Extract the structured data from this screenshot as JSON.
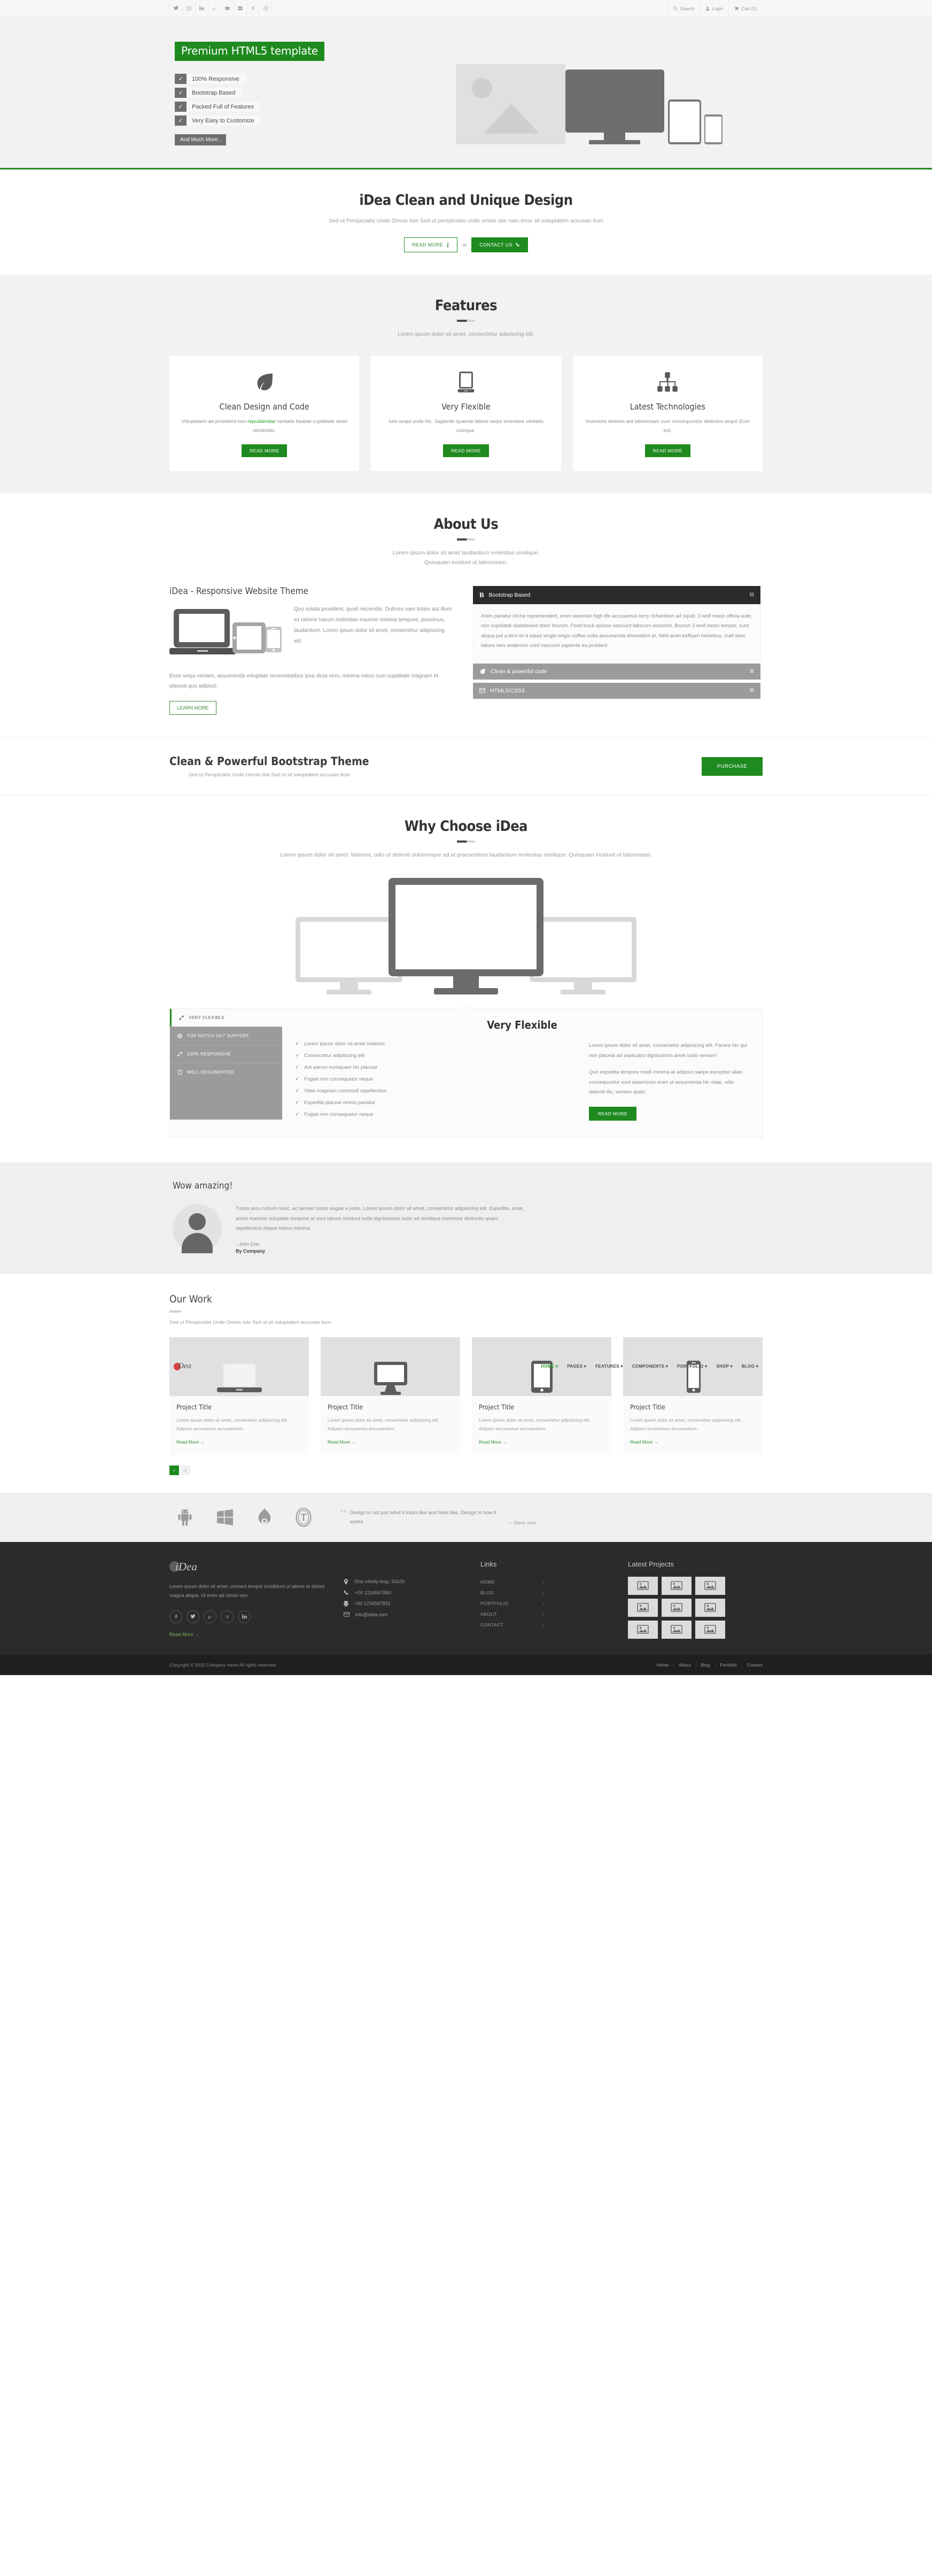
{
  "topbar": {
    "social": [
      "twitter-icon",
      "skype-icon",
      "linkedin-icon",
      "google-plus-icon",
      "youtube-icon",
      "flickr-icon",
      "facebook-icon",
      "pinterest-icon"
    ],
    "search": "Search",
    "login": "Login",
    "cart": "Cart (0)"
  },
  "hero": {
    "badge": "Premium HTML5 template",
    "features": [
      "100% Responsive",
      "Bootstrap Based",
      "Packed Full of Features",
      "Very Easy to Customize"
    ],
    "more": "And Much More.."
  },
  "intro": {
    "title": "iDea Clean and Unique Design",
    "subtitle": "Sed ut Perspiciatis Unde Omnis Iste Sed ut perspiciatis unde omnis iste natu error sit voluptatem accusan tium",
    "read_more": "READ MORE",
    "or": "or",
    "contact_us": "CONTACT US"
  },
  "features": {
    "title": "Features",
    "subtitle": "Lorem ipsum dolor sit amet, consectetur adipiscing elit.",
    "cards": [
      {
        "icon": "leaf-icon",
        "title": "Clean Design and Code",
        "text_before": "Voluptatem ad provident non ",
        "highlight": "repudiandae",
        "text_after": " veritatis beatae cupiditate amet reiciendis.",
        "button": "READ MORE"
      },
      {
        "icon": "tablet-icon",
        "title": "Very Flexible",
        "text_before": "Iure sequi unde hic. Sapiente quaerat labore sequi inventore veritatis cumque.",
        "highlight": "",
        "text_after": "",
        "button": "READ MORE"
      },
      {
        "icon": "sitemap-icon",
        "title": "Latest Technologies",
        "text_before": "Inventore dolores aut laboriosam cum consequuntur delectus sequi! Eum est.",
        "highlight": "",
        "text_after": "",
        "button": "READ MORE"
      }
    ]
  },
  "about": {
    "title": "About Us",
    "subtitle": "Lorem ipsum dolor sit amet laudantium molestias similique.\nQuisquam incidunt ut laboriosam.",
    "heading": "iDea - Responsive Website Theme",
    "paragraph1": "Quo soluta provident, quod reiciendis. Dolores nam totam aut illum ex ratione harum molestias maxime minima tempore, possimus, laudantium. Lorem ipsum dolor sit amet, consectetur adipisicing elit.",
    "paragraph2": "Esse sequi veniam, assumenda voluptate necessitatibus ipsa dicta vero, minima natus cum cupiditate magnam et placeat quo adipisci.",
    "learn_more": "LEARN MORE",
    "accordion": [
      {
        "icon": "bootstrap-icon",
        "label": "Bootstrap Based",
        "state": "open",
        "sign": "⊟",
        "body": "Anim pariatur cliche reprehenderit, enim eiusmod high life accusamus terry richardson ad squid. 3 wolf moon officia aute, non cupidatat skateboard dolor brunch. Food truck quinoa nesciunt laborum eiusmod. Brunch 3 wolf moon tempor, sunt aliqua put a bird on it squid single-origin coffee nulla assumenda shoreditch et. Nihil anim keffiyeh helvetica, craft beer labore wes anderson cred nesciunt sapiente ea proident."
      },
      {
        "icon": "leaf-icon",
        "label": "Clean & powerful code",
        "state": "closed",
        "sign": "⊞",
        "body": ""
      },
      {
        "icon": "code-icon",
        "label": "HTML5/CSS3",
        "state": "closed",
        "sign": "⊞",
        "body": ""
      }
    ]
  },
  "cta": {
    "title": "Clean & Powerful Bootstrap Theme",
    "subtitle": "Sed ut Perspiciatis Unde Omnis Iste Sed ut sit voluptatem accusan tium",
    "button": "PURCHASE"
  },
  "why": {
    "title": "Why Choose iDea",
    "subtitle": "Lorem ipsum dolor sit amet. Maiores, odio ut deleniti doloremque ad at praesentium laudantium molestias similique. Quisquam incidunt ut laboriosam.",
    "tabs": [
      {
        "icon": "expand-icon",
        "label": "VERY FLEXIBLE",
        "active": true
      },
      {
        "icon": "lifebuoy-icon",
        "label": "TOP NOTCH 24/7 SUPPORT",
        "active": false
      },
      {
        "icon": "expand-icon",
        "label": "100% RESPONSIVE",
        "active": false
      },
      {
        "icon": "file-icon",
        "label": "WELL DOCUMENTED",
        "active": false
      }
    ],
    "panel_title": "Very Flexible",
    "checklist": [
      "Lorem ipsum dolor sit amet maiores",
      "Consectetur adipisicing elit",
      "Aut earum numquam hic placeat",
      "Fugiat rem consequatur neque",
      "Vitae magnam commodi repellendus",
      "Expedita placeat omnis pariatur",
      "Fugiat rem consequatur neque"
    ],
    "paragraph1": "Lorem ipsum dolor sit amet, consectetur adipisicing elit. Facere hic qui non placeat ad explicabo dignissimos amet iusto veniam!",
    "paragraph2": "Quo expedita tempore modi minima at adipisci saepe excepturi alias consequuntur sunt asperiores enim ut assumenda hic vitae, odio deleniti illo, veniam quas!",
    "button": "READ MORE"
  },
  "testimonial": {
    "title": "Wow amazing!",
    "text": "Turpis arcu rutrum nunc, ac laoreet turpis augue a justo. Lorem ipsum dolor sit amet, consectetur adipisicing elit. Expedita, esse, animi maxime voluptate tempore at sunt labore incidunt nulla dignissimos iusto ad similique inventore distinctio quam repellendus itaque minus minima.",
    "author": "- John Doe",
    "company": "By Company"
  },
  "work": {
    "title": "Our Work",
    "subtitle": "Sed ut Perspiciatis Unde Omnis Iste Sed ut sit voluptatem accusan tium",
    "nav_logo": "Dea",
    "nav_items": [
      "HOME",
      "PAGES",
      "FEATURES",
      "COMPONENTS",
      "PORTFOLIO",
      "SHOP",
      "BLOG"
    ],
    "projects": [
      {
        "thumb": "laptop-icon",
        "title": "Project Title",
        "text": "Lorem ipsum dolor sit amet, consectetur adipisicing elit. Adipisci accusamus accusantium.",
        "link": "Read More →"
      },
      {
        "thumb": "desktop-icon",
        "title": "Project Title",
        "text": "Lorem ipsum dolor sit amet, consectetur adipisicing elit. Adipisci accusamus accusantium.",
        "link": "Read More →"
      },
      {
        "thumb": "tablet-icon",
        "title": "Project Title",
        "text": "Lorem ipsum dolor sit amet, consectetur adipisicing elit. Adipisci accusamus accusantium.",
        "link": "Read More →"
      },
      {
        "thumb": "mobile-icon",
        "title": "Project Title",
        "text": "Lorem ipsum dolor sit amet, consectetur adipisicing elit. Adipisci accusamus accusantium.",
        "link": "Read More →"
      }
    ],
    "pager_prev": "‹",
    "pager_next": "›"
  },
  "brands": {
    "icons": [
      "android-icon",
      "windows-icon",
      "drupal-icon",
      "wordpress-icon"
    ],
    "quote": "Design is not just what it looks like and feels like. Design is how it works.",
    "author": "— Steve Jobs"
  },
  "footer": {
    "logo": "Dea",
    "about": "Lorem ipsum dolor sit amet, consect tempor incididunt ut labore et dolore magna aliqua. Ut enim ad minim ven.",
    "social": [
      "facebook-icon",
      "twitter-icon",
      "google-plus-icon",
      "skype-icon",
      "linkedin-icon"
    ],
    "read_more": "Read More →",
    "links_title": "Links",
    "links": [
      "HOME",
      "BLOG",
      "PORTFOLIO",
      "ABOUT",
      "CONTACT"
    ],
    "contact": [
      {
        "icon": "location-icon",
        "text": "One infinity loop, 54100"
      },
      {
        "icon": "phone-icon",
        "text": "+00 1234567890"
      },
      {
        "icon": "fax-icon",
        "text": "+00 1234567891"
      },
      {
        "icon": "mail-icon",
        "text": "info@idea.com"
      }
    ],
    "projects_title": "Latest Projects",
    "project_thumb_count": 9,
    "copyright": "Copyright © 2015.Company name All rights reserved.",
    "nav": [
      "Home",
      "About",
      "Blog",
      "Portfolio",
      "Contact"
    ]
  },
  "colors": {
    "green": "#1f8a1f",
    "dark": "#2b2b2b",
    "grey": "#9b9b9b",
    "light": "#f2f2f2"
  }
}
